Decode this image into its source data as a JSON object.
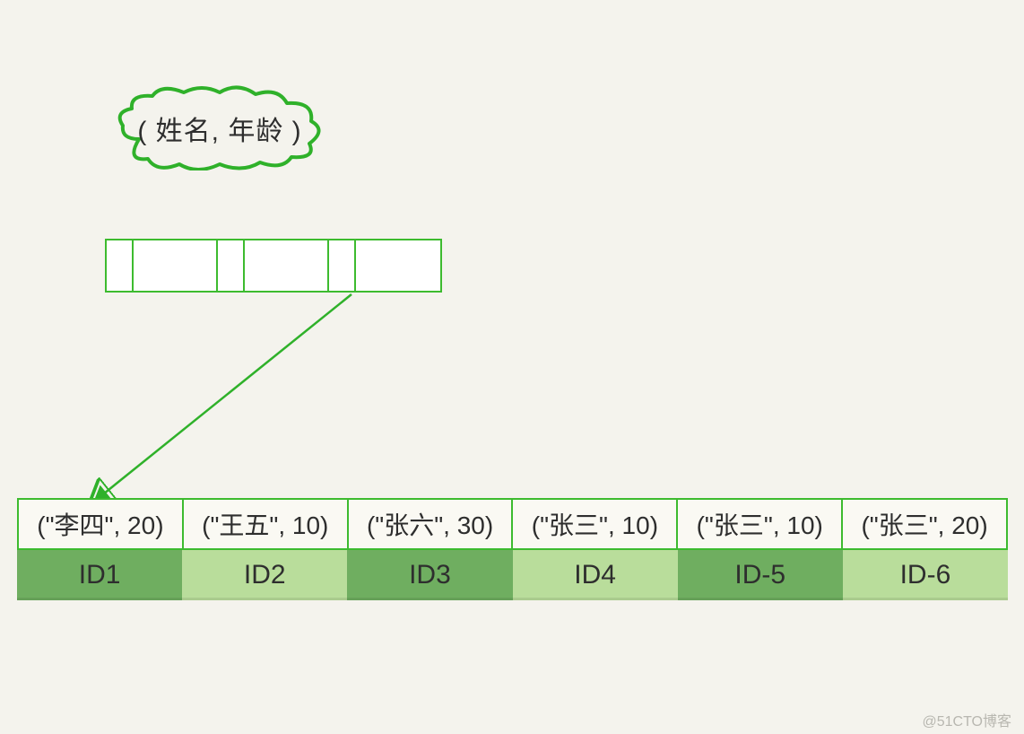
{
  "cloud_label": "( 姓名, 年龄 )",
  "records": [
    {
      "tuple": "(\"李四\", 20)",
      "id": "ID1",
      "shade": "dark"
    },
    {
      "tuple": "(\"王五\", 10)",
      "id": "ID2",
      "shade": "light"
    },
    {
      "tuple": "(\"张六\", 30)",
      "id": "ID3",
      "shade": "dark"
    },
    {
      "tuple": "(\"张三\", 10)",
      "id": "ID4",
      "shade": "light"
    },
    {
      "tuple": "(\"张三\", 10)",
      "id": "ID-5",
      "shade": "dark"
    },
    {
      "tuple": "(\"张三\", 20)",
      "id": "ID-6",
      "shade": "light"
    }
  ],
  "watermark": "@51CTO博客",
  "colors": {
    "green_border": "#3dbb2f",
    "id_dark": "#6fae60",
    "id_light": "#b9dd9b",
    "bg": "#f4f3ed"
  }
}
